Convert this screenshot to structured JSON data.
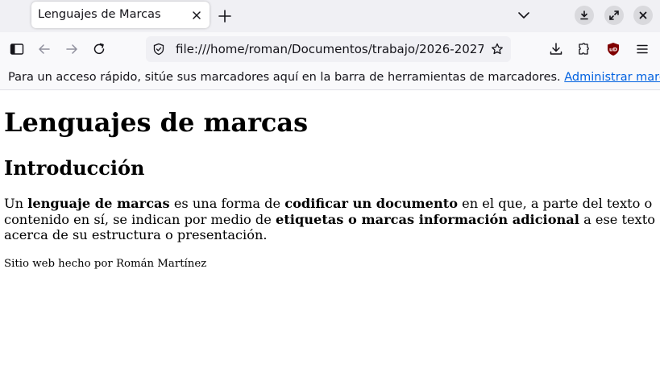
{
  "browser": {
    "tab": {
      "title": "Lenguajes de Marcas"
    },
    "url": "file:///home/roman/Documentos/trabajo/2026-2027",
    "bookmarks_bar": {
      "message": "Para un acceso rápido, sitúe sus marcadores aquí en la barra de herramientas de marcadores.",
      "manage_link": "Administrar marcadores…"
    }
  },
  "page": {
    "heading": "Lenguajes de marcas",
    "subheading": "Introducción",
    "paragraph": {
      "t1": "Un ",
      "b1": "lenguaje de marcas",
      "t2": " es una forma de ",
      "b2": "codificar un documento",
      "t3": " en el que, a parte del texto o contenido en sí, se indican por medio de ",
      "b3": "etiquetas o marcas información adicional",
      "t4": " a ese texto acerca de su estructura o presentación."
    },
    "footer": "Sitio web hecho por Román Martínez"
  },
  "colors": {
    "tabstrip_bg": "#f0f0f4",
    "toolbar_bg": "#f9f9fb",
    "link": "#0061e0",
    "ublock": "#800000"
  }
}
